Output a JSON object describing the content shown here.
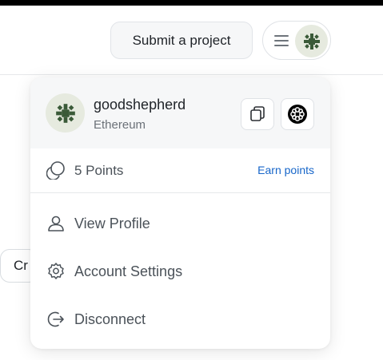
{
  "header": {
    "submit_label": "Submit a project"
  },
  "background": {
    "chip_text": "Cr"
  },
  "account": {
    "name": "goodshepherd",
    "network": "Ethereum"
  },
  "points": {
    "label": "5 Points",
    "earn_label": "Earn points"
  },
  "menu": {
    "items": [
      {
        "label": "View Profile",
        "icon": "user-icon"
      },
      {
        "label": "Account Settings",
        "icon": "gear-icon"
      },
      {
        "label": "Disconnect",
        "icon": "logout-icon"
      }
    ]
  },
  "colors": {
    "accent_link": "#1766c9",
    "avatar_bg": "#e6eadf",
    "avatar_glyph": "#3a5a38"
  }
}
